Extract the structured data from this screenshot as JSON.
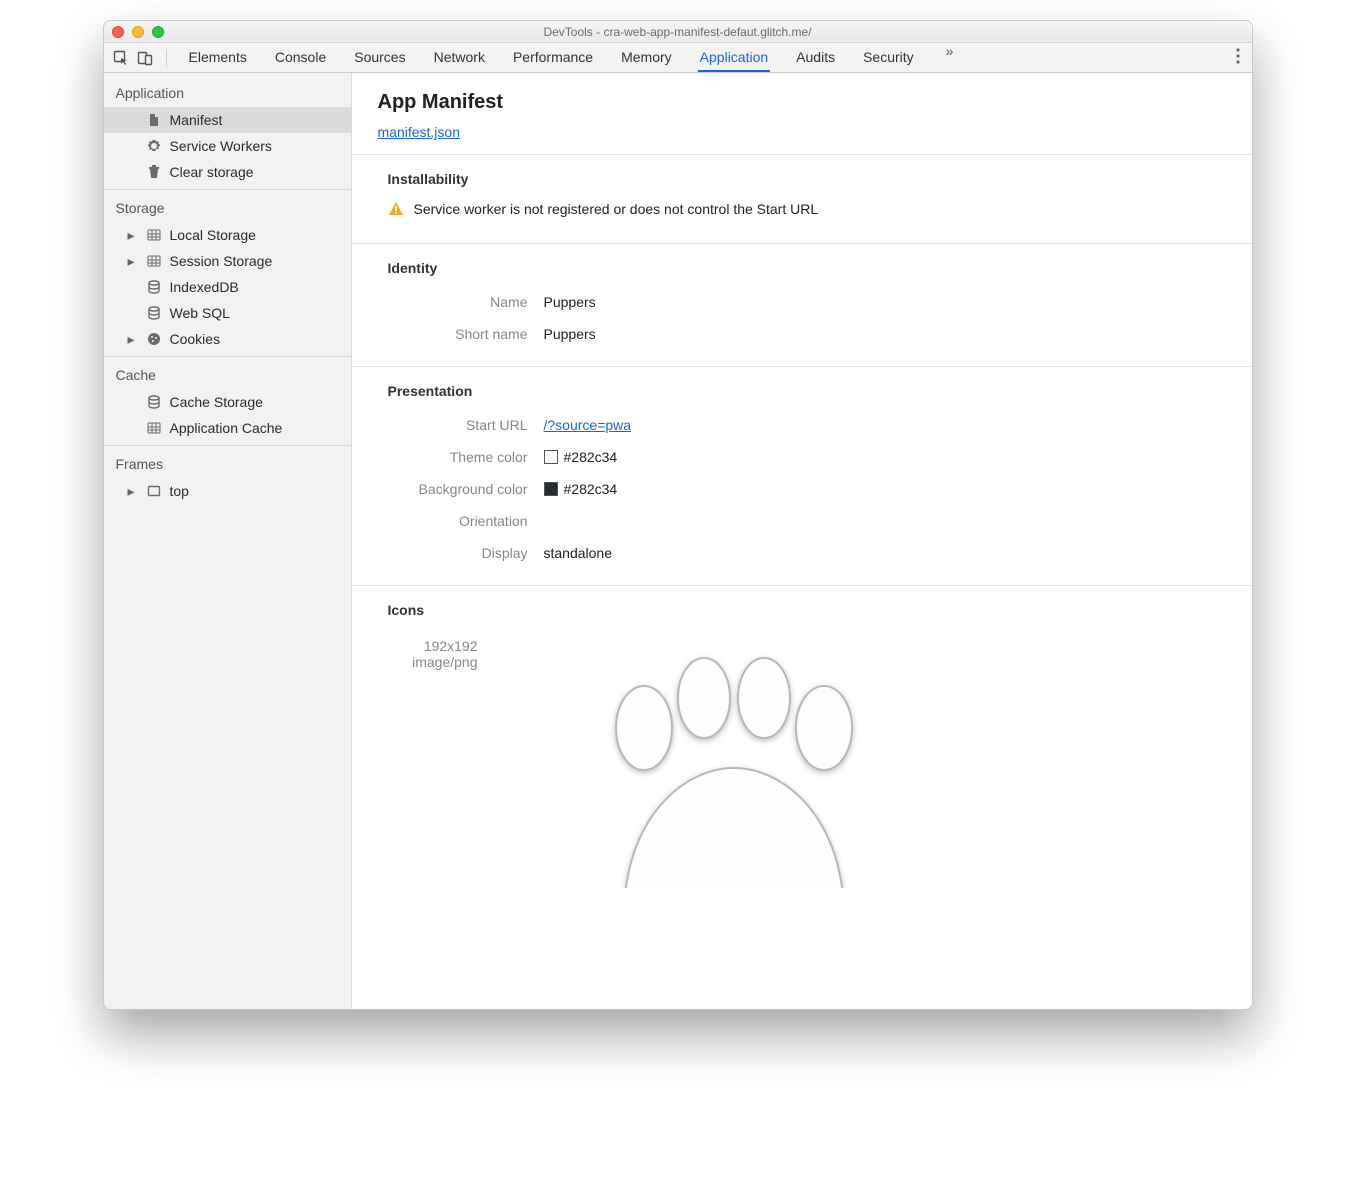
{
  "window": {
    "title": "DevTools - cra-web-app-manifest-defaut.glitch.me/"
  },
  "tabs": {
    "items": [
      {
        "label": "Elements",
        "active": false
      },
      {
        "label": "Console",
        "active": false
      },
      {
        "label": "Sources",
        "active": false
      },
      {
        "label": "Network",
        "active": false
      },
      {
        "label": "Performance",
        "active": false
      },
      {
        "label": "Memory",
        "active": false
      },
      {
        "label": "Application",
        "active": true
      },
      {
        "label": "Audits",
        "active": false
      },
      {
        "label": "Security",
        "active": false
      }
    ],
    "more_glyph": "»"
  },
  "sidebar": {
    "sections": {
      "application": {
        "title": "Application",
        "manifest": "Manifest",
        "service_workers": "Service Workers",
        "clear_storage": "Clear storage"
      },
      "storage": {
        "title": "Storage",
        "local_storage": "Local Storage",
        "session_storage": "Session Storage",
        "indexeddb": "IndexedDB",
        "websql": "Web SQL",
        "cookies": "Cookies"
      },
      "cache": {
        "title": "Cache",
        "cache_storage": "Cache Storage",
        "application_cache": "Application Cache"
      },
      "frames": {
        "title": "Frames",
        "top": "top"
      }
    }
  },
  "manifest": {
    "heading": "App Manifest",
    "link_text": "manifest.json",
    "installability": {
      "heading": "Installability",
      "warning": "Service worker is not registered or does not control the Start URL"
    },
    "identity": {
      "heading": "Identity",
      "name_label": "Name",
      "name_value": "Puppers",
      "short_name_label": "Short name",
      "short_name_value": "Puppers"
    },
    "presentation": {
      "heading": "Presentation",
      "start_url_label": "Start URL",
      "start_url_value": "/?source=pwa",
      "theme_color_label": "Theme color",
      "theme_color_value": "#282c34",
      "background_color_label": "Background color",
      "background_color_value": "#282c34",
      "orientation_label": "Orientation",
      "orientation_value": "",
      "display_label": "Display",
      "display_value": "standalone"
    },
    "icons": {
      "heading": "Icons",
      "size": "192x192",
      "mime": "image/png"
    }
  },
  "colors": {
    "swatch": "#282c34"
  }
}
